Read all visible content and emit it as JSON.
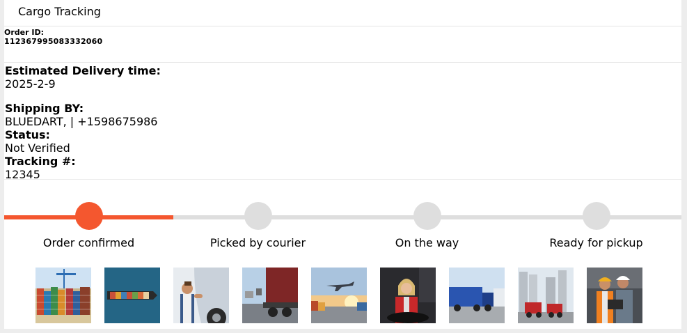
{
  "header": {
    "title": "Cargo Tracking"
  },
  "order": {
    "label": "Order ID:",
    "id": "112367995083332060"
  },
  "delivery": {
    "label": "Estimated Delivery time:",
    "value": "2025-2-9"
  },
  "shipping": {
    "label": "Shipping BY:",
    "value": "BLUEDART, | +1598675986"
  },
  "status": {
    "label": "Status:",
    "value": "Not Verified"
  },
  "tracking": {
    "label": "Tracking #:",
    "value": "12345"
  },
  "progress": {
    "completed_fraction": 0.25,
    "accent_color": "#f4572f",
    "inactive_color": "#dedede",
    "steps": [
      {
        "label": "Order confirmed",
        "active": true
      },
      {
        "label": "Picked by courier",
        "active": false
      },
      {
        "label": "On the way",
        "active": false
      },
      {
        "label": "Ready for pickup",
        "active": false
      }
    ]
  },
  "gallery": [
    {
      "name": "container-port-photo"
    },
    {
      "name": "cargo-ship-photo"
    },
    {
      "name": "truck-driver-thumbs-up-photo"
    },
    {
      "name": "truck-on-road-photo"
    },
    {
      "name": "airplane-over-containers-photo"
    },
    {
      "name": "woman-driving-truck-photo"
    },
    {
      "name": "blue-trucks-parked-photo"
    },
    {
      "name": "trucks-at-silos-photo"
    },
    {
      "name": "workers-with-laptop-photo"
    }
  ]
}
